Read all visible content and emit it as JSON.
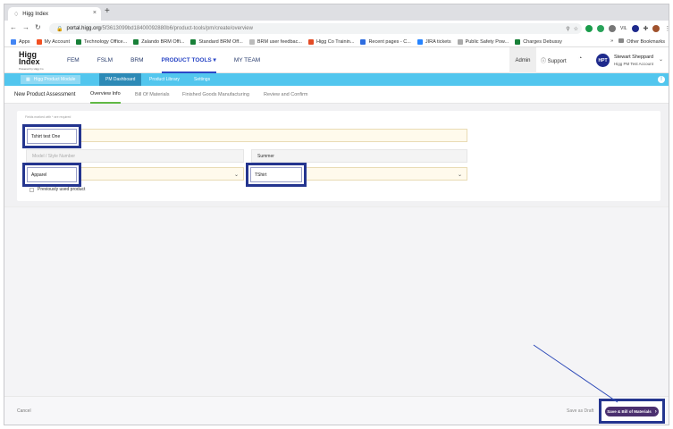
{
  "browser": {
    "tab_title": "Higg Index",
    "tab_close": "×",
    "new_tab": "+",
    "url_host": "portal.higg.org",
    "url_path": "/5f3613099bd18400092880b6/product-tools/pm/create/overview",
    "ext_initial": "VIL"
  },
  "bookmarks": [
    {
      "label": "Apps",
      "color": "#4285f4"
    },
    {
      "label": "My Account",
      "color": "#f25022"
    },
    {
      "label": "Technology Office...",
      "color": "#188038"
    },
    {
      "label": "Zalando BRM Offi...",
      "color": "#188038"
    },
    {
      "label": "Standard BRM Off...",
      "color": "#188038"
    },
    {
      "label": "BRM user feedbac...",
      "color": "#bbbbbb"
    },
    {
      "label": "Higg Co Trainin...",
      "color": "#e34c26"
    },
    {
      "label": "Recent pages - C...",
      "color": "#2d6cdf"
    },
    {
      "label": "JIRA tickets",
      "color": "#2684ff"
    },
    {
      "label": "Public Safety Pow...",
      "color": "#aaaaaa"
    },
    {
      "label": "Charges Debussy",
      "color": "#188038"
    }
  ],
  "bookmarks_more": "»",
  "bookmarks_other": "Other Bookmarks",
  "app": {
    "logo_text": "Higg Index",
    "logo_sub": "Powered by Higg Co",
    "nav": [
      "FEM",
      "FSLM",
      "BRM",
      "PRODUCT TOOLS ▾",
      "MY TEAM"
    ],
    "admin": "Admin",
    "support": "Support",
    "avatar": "HPT",
    "user_name": "Stewart Sheppard",
    "user_org": "Higg PM Test Account"
  },
  "subnav": {
    "module": "Higg Product Module",
    "items": [
      "PM Dashboard",
      "Product Library",
      "Settings"
    ]
  },
  "page": {
    "title": "New Product Assessment",
    "tabs": [
      "Overview Info",
      "Bill Of Materials",
      "Finished Goods Manufacturing",
      "Review and Confirm"
    ]
  },
  "form": {
    "required_note": "Fields marked with * are required",
    "product_name": "Tshirt test One",
    "model_placeholder": "Model / Style Number",
    "season": "Summer",
    "category": "Apparel",
    "product_type": "TShirt",
    "previously_used": "Previously used product"
  },
  "footer": {
    "cancel": "Cancel",
    "save_draft": "Save as Draft",
    "save_next": "Save & Bill of Materials"
  },
  "colors": {
    "accent_cyan": "#52c6ee",
    "primary_nav": "#2b47c6",
    "save_button": "#4a2f6e",
    "highlight": "#24358f"
  }
}
